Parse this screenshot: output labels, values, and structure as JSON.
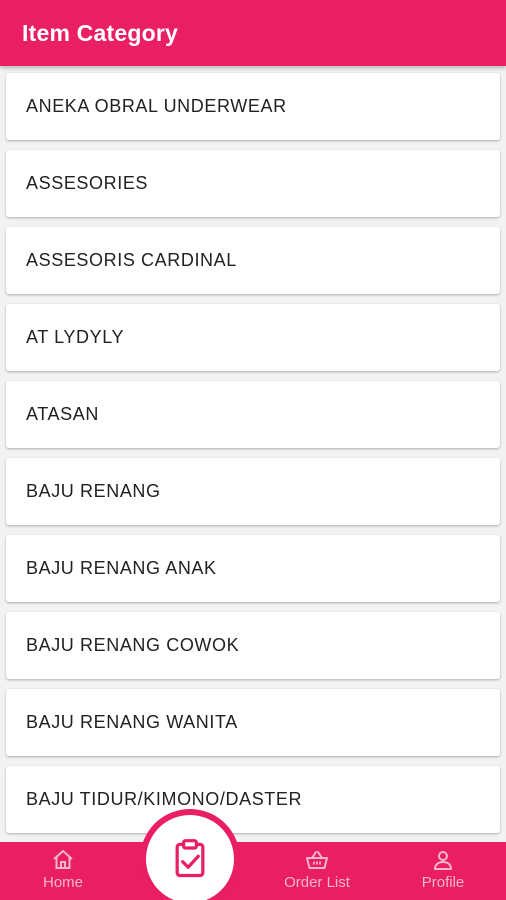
{
  "appbar": {
    "title": "Item Category"
  },
  "categories": [
    "ANEKA OBRAL UNDERWEAR",
    "ASSESORIES",
    "ASSESORIS CARDINAL",
    "AT LYDYLY",
    "ATASAN",
    "BAJU RENANG",
    "BAJU RENANG ANAK",
    "BAJU RENANG COWOK",
    "BAJU RENANG WANITA",
    "BAJU TIDUR/KIMONO/DASTER"
  ],
  "bottom_nav": {
    "home_label": "Home",
    "order_label": "Order List",
    "profile_label": "Profile",
    "home_icon": "home-icon",
    "order_icon": "basket-icon",
    "profile_icon": "person-icon",
    "center_icon": "clipboard-check-icon"
  },
  "colors": {
    "primary": "#e91e63",
    "nav_text": "#f6b6cc",
    "card_bg": "#ffffff",
    "page_bg": "#f2f2f2"
  }
}
